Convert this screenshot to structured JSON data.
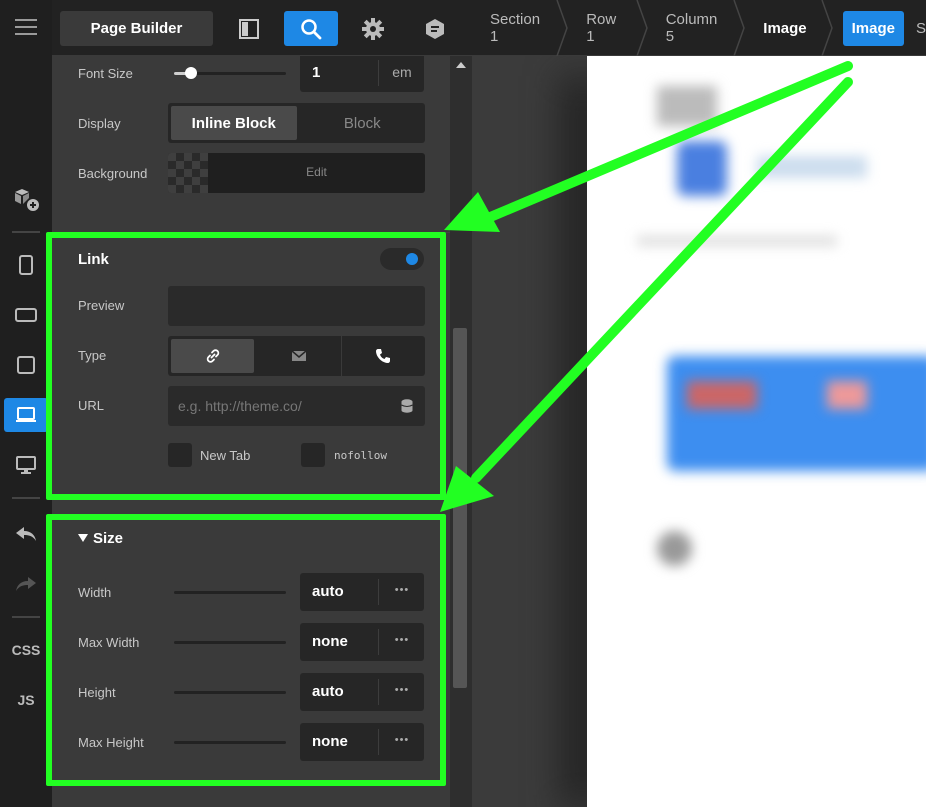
{
  "topbar": {
    "page_builder_label": "Page Builder"
  },
  "breadcrumbs": [
    "Section 1",
    "Row 1",
    "Column 5",
    "Image"
  ],
  "breadcrumb_active": "Image",
  "breadcrumb_more": "S",
  "rail": {
    "css_label": "CSS",
    "js_label": "JS"
  },
  "font_size": {
    "label": "Font Size",
    "value": "1",
    "unit": "em",
    "slider_level": 0.15
  },
  "display": {
    "label": "Display",
    "options": [
      "Inline Block",
      "Block"
    ],
    "selected": "Inline Block"
  },
  "background": {
    "label": "Background",
    "edit_label": "Edit"
  },
  "link": {
    "title": "Link",
    "enabled": true,
    "preview_label": "Preview",
    "type_label": "Type",
    "type_options": [
      "link-icon",
      "envelope-icon",
      "phone-icon"
    ],
    "url_label": "URL",
    "url_placeholder": "e.g. http://theme.co/",
    "new_tab_label": "New Tab",
    "nofollow_label": "nofollow"
  },
  "size": {
    "title": "Size",
    "rows": [
      {
        "label": "Width",
        "value": "auto"
      },
      {
        "label": "Max Width",
        "value": "none"
      },
      {
        "label": "Height",
        "value": "auto"
      },
      {
        "label": "Max Height",
        "value": "none"
      }
    ],
    "more_glyph": "•••"
  },
  "colors": {
    "accent": "#1e88e5",
    "highlight": "#22ff22"
  }
}
